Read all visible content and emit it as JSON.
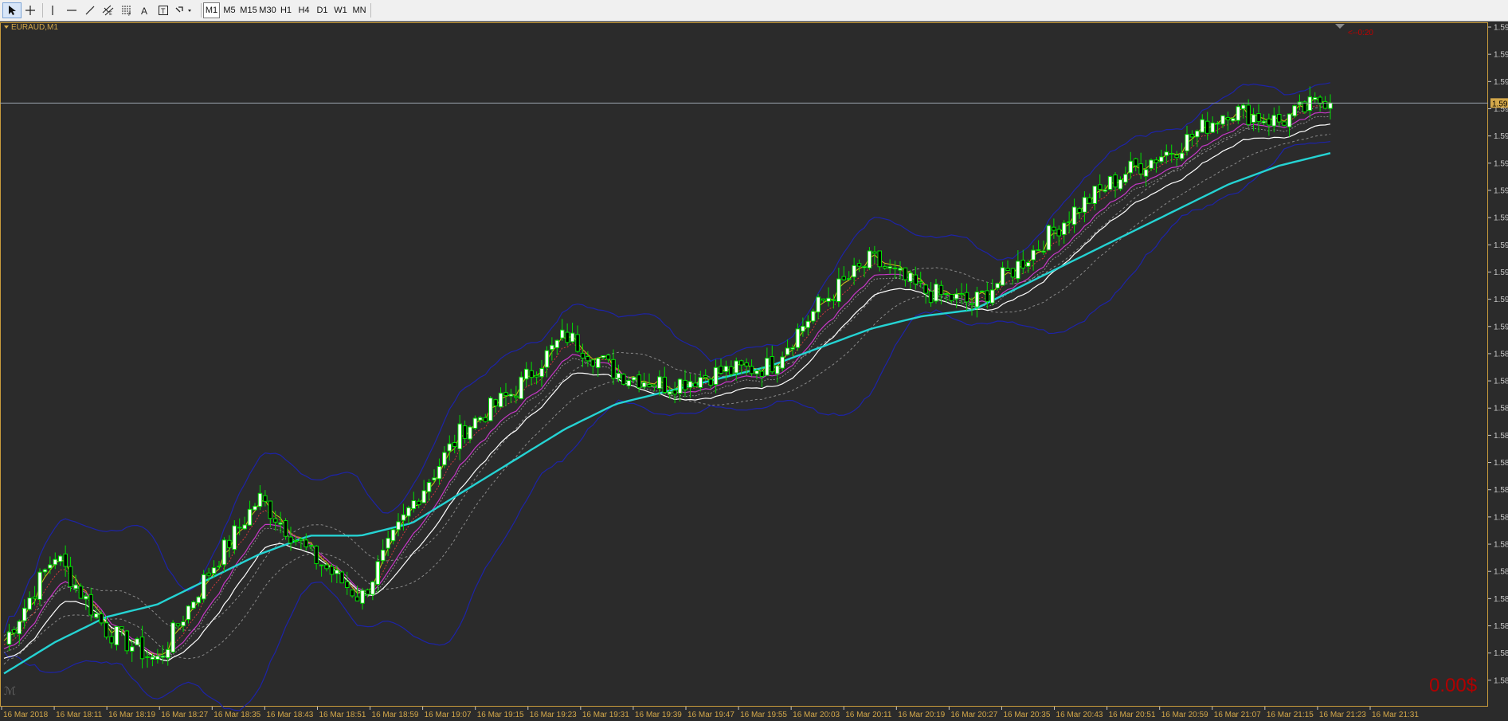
{
  "toolbar": {
    "tools": [
      {
        "name": "cursor-icon"
      },
      {
        "name": "crosshair-icon"
      },
      {
        "name": "vertical-line-icon"
      },
      {
        "name": "horizontal-line-icon"
      },
      {
        "name": "trendline-icon"
      },
      {
        "name": "equidistant-channel-icon"
      },
      {
        "name": "fibonacci-icon"
      },
      {
        "name": "text-icon"
      },
      {
        "name": "text-label-icon"
      },
      {
        "name": "arrows-icon"
      }
    ],
    "timeframes": [
      {
        "label": "M1",
        "active": true
      },
      {
        "label": "M5",
        "active": false
      },
      {
        "label": "M15",
        "active": false
      },
      {
        "label": "M30",
        "active": false
      },
      {
        "label": "H1",
        "active": false
      },
      {
        "label": "H4",
        "active": false
      },
      {
        "label": "D1",
        "active": false
      },
      {
        "label": "W1",
        "active": false
      },
      {
        "label": "MN",
        "active": false
      }
    ]
  },
  "chart": {
    "symbol_label": "EURAUD,M1",
    "countdown": "<--0:20",
    "profit": "0.00$",
    "price_tag": "1.59",
    "colors": {
      "background": "#2b2b2b",
      "border": "#c89b3c",
      "axis_text": "#c8c8c8",
      "time_text": "#d4a84a",
      "candle": "#00e000",
      "candle_bull_body": "#ffffff",
      "bollinger": "#1d23a8",
      "ma_slow": "#25d3d3",
      "ma_fast": "#ffffff",
      "ma_yellow": "#d4c21a",
      "ma_red": "#d23b3b",
      "ma_magenta": "#c638c6",
      "dashed": "#8a8a8a",
      "profit": "#b00000",
      "countdown": "#c00000"
    },
    "price_labels": [
      "1.59",
      "1.59",
      "1.59",
      "1.59",
      "1.59",
      "1.59",
      "1.59",
      "1.59",
      "1.59",
      "1.59",
      "1.59",
      "1.59",
      "1.58",
      "1.58",
      "1.58",
      "1.58",
      "1.58",
      "1.58",
      "1.58",
      "1.58",
      "1.58",
      "1.58",
      "1.58",
      "1.58",
      "1.58"
    ],
    "time_labels": [
      "16 Mar 2018",
      "16 Mar 18:11",
      "16 Mar 18:19",
      "16 Mar 18:27",
      "16 Mar 18:35",
      "16 Mar 18:43",
      "16 Mar 18:51",
      "16 Mar 18:59",
      "16 Mar 19:07",
      "16 Mar 19:15",
      "16 Mar 19:23",
      "16 Mar 19:31",
      "16 Mar 19:39",
      "16 Mar 19:47",
      "16 Mar 19:55",
      "16 Mar 20:03",
      "16 Mar 20:11",
      "16 Mar 20:19",
      "16 Mar 20:27",
      "16 Mar 20:35",
      "16 Mar 20:43",
      "16 Mar 20:51",
      "16 Mar 20:59",
      "16 Mar 21:07",
      "16 Mar 21:15",
      "16 Mar 21:23",
      "16 Mar 21:31"
    ]
  },
  "chart_data": {
    "type": "line",
    "title": "EURAUD,M1",
    "x": [
      "16 Mar 2018",
      "16 Mar 18:11",
      "16 Mar 18:19",
      "16 Mar 18:27",
      "16 Mar 18:35",
      "16 Mar 18:43",
      "16 Mar 18:51",
      "16 Mar 18:59",
      "16 Mar 19:07",
      "16 Mar 19:15",
      "16 Mar 19:23",
      "16 Mar 19:31",
      "16 Mar 19:39",
      "16 Mar 19:47",
      "16 Mar 19:55",
      "16 Mar 20:03",
      "16 Mar 20:11",
      "16 Mar 20:19",
      "16 Mar 20:27",
      "16 Mar 20:35",
      "16 Mar 20:43",
      "16 Mar 20:51",
      "16 Mar 20:59",
      "16 Mar 21:07",
      "16 Mar 21:15",
      "16 Mar 21:23",
      "16 Mar 21:31"
    ],
    "series": [
      {
        "values": [
          0.08,
          0.22,
          0.1,
          0.05,
          0.19,
          0.31,
          0.22,
          0.15,
          0.3,
          0.42,
          0.48,
          0.57,
          0.51,
          0.49,
          0.51,
          0.52,
          0.62,
          0.69,
          0.64,
          0.62,
          0.69,
          0.77,
          0.83,
          0.87,
          0.93,
          0.91,
          0.95
        ]
      },
      {
        "values": [
          0.03,
          0.08,
          0.12,
          0.14,
          0.18,
          0.22,
          0.25,
          0.25,
          0.27,
          0.32,
          0.37,
          0.42,
          0.46,
          0.48,
          0.5,
          0.52,
          0.55,
          0.58,
          0.6,
          0.61,
          0.65,
          0.69,
          0.73,
          0.77,
          0.81,
          0.84,
          0.86
        ]
      }
    ],
    "ylim": [
      0,
      1
    ],
    "grid": false
  }
}
